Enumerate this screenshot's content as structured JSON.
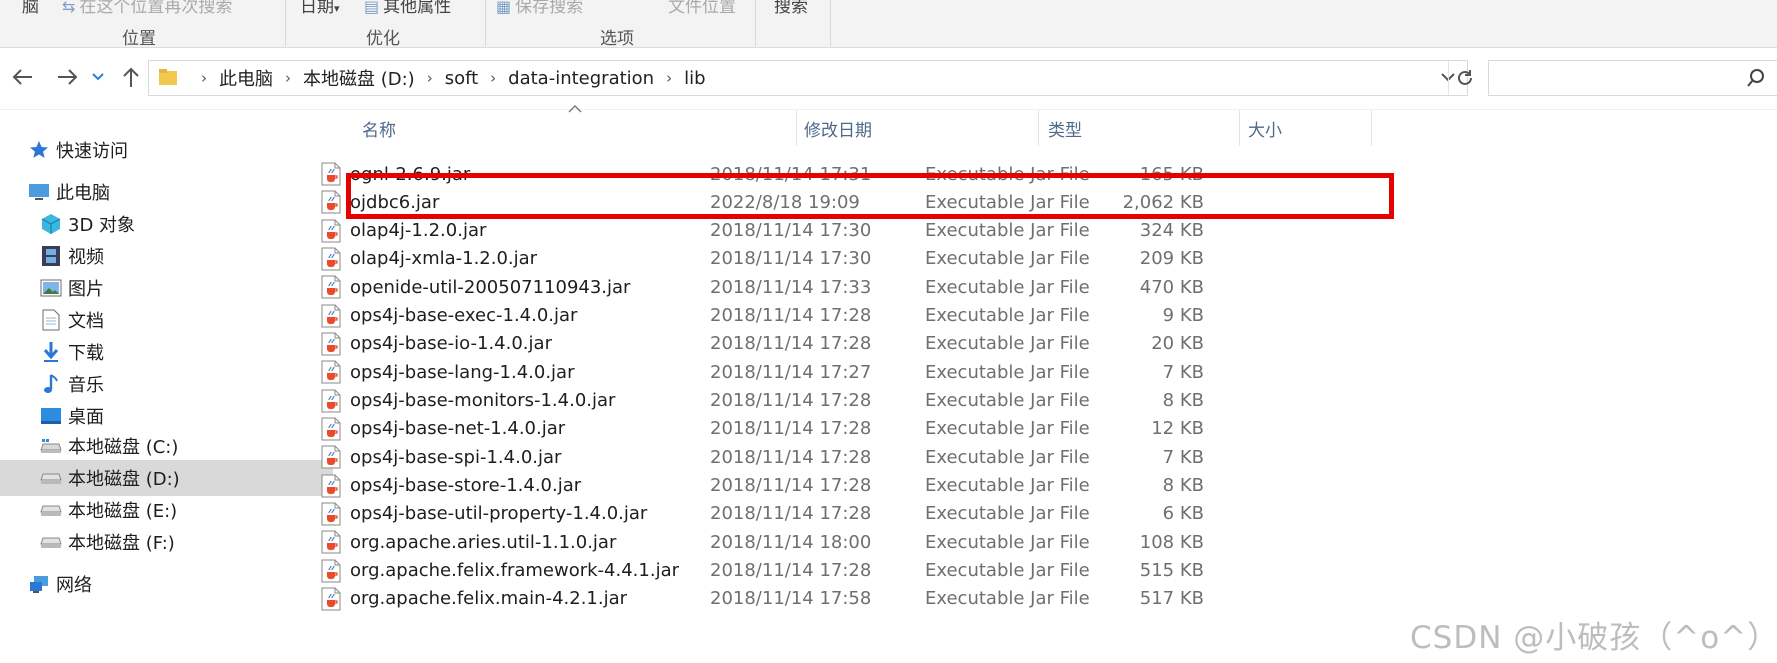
{
  "ribbon": {
    "buttons": [
      {
        "label": "脑",
        "icon": "",
        "dim": false
      },
      {
        "label": "在这个位置再次搜索",
        "icon": "search-again-icon",
        "dim": true
      },
      {
        "label": "日期",
        "icon": "",
        "dim": false
      },
      {
        "label": "其他属性",
        "icon": "properties-icon",
        "dim": false
      },
      {
        "label": "保存搜索",
        "icon": "save-search-icon",
        "dim": true
      },
      {
        "label": "文件位置",
        "icon": "",
        "dim": true
      },
      {
        "label": "搜索",
        "icon": "",
        "dim": false
      }
    ],
    "groups": [
      "位置",
      "优化",
      "选项"
    ]
  },
  "address": {
    "crumbs": [
      "此电脑",
      "本地磁盘 (D:)",
      "soft",
      "data-integration",
      "lib"
    ],
    "search_placeholder": ""
  },
  "nav": {
    "items": [
      {
        "label": "快速访问",
        "icon": "star-icon",
        "indent": 1,
        "selected": false
      },
      {
        "label": "此电脑",
        "icon": "computer-icon",
        "indent": 1,
        "selected": false
      },
      {
        "label": "3D 对象",
        "icon": "3d-objects-icon",
        "indent": 2,
        "selected": false
      },
      {
        "label": "视频",
        "icon": "video-icon",
        "indent": 2,
        "selected": false
      },
      {
        "label": "图片",
        "icon": "pictures-icon",
        "indent": 2,
        "selected": false
      },
      {
        "label": "文档",
        "icon": "documents-icon",
        "indent": 2,
        "selected": false
      },
      {
        "label": "下载",
        "icon": "download-icon",
        "indent": 2,
        "selected": false
      },
      {
        "label": "音乐",
        "icon": "music-icon",
        "indent": 2,
        "selected": false
      },
      {
        "label": "桌面",
        "icon": "desktop-icon",
        "indent": 2,
        "selected": false
      },
      {
        "label": "本地磁盘 (C:)",
        "icon": "drive-c-icon",
        "indent": 2,
        "selected": false
      },
      {
        "label": "本地磁盘 (D:)",
        "icon": "drive-icon",
        "indent": 2,
        "selected": true
      },
      {
        "label": "本地磁盘 (E:)",
        "icon": "drive-icon",
        "indent": 2,
        "selected": false
      },
      {
        "label": "本地磁盘 (F:)",
        "icon": "drive-icon",
        "indent": 2,
        "selected": false
      },
      {
        "label": "网络",
        "icon": "network-icon",
        "indent": 1,
        "selected": false
      }
    ]
  },
  "list": {
    "headers": {
      "name": "名称",
      "modified": "修改日期",
      "type": "类型",
      "size": "大小"
    },
    "rows": [
      {
        "name": "ognl-2.6.9.jar",
        "modified": "2018/11/14 17:31",
        "type": "Executable Jar File",
        "size": "165 KB"
      },
      {
        "name": "ojdbc6.jar",
        "modified": "2022/8/18 19:09",
        "type": "Executable Jar File",
        "size": "2,062 KB"
      },
      {
        "name": "olap4j-1.2.0.jar",
        "modified": "2018/11/14 17:30",
        "type": "Executable Jar File",
        "size": "324 KB"
      },
      {
        "name": "olap4j-xmla-1.2.0.jar",
        "modified": "2018/11/14 17:30",
        "type": "Executable Jar File",
        "size": "209 KB"
      },
      {
        "name": "openide-util-200507110943.jar",
        "modified": "2018/11/14 17:33",
        "type": "Executable Jar File",
        "size": "470 KB"
      },
      {
        "name": "ops4j-base-exec-1.4.0.jar",
        "modified": "2018/11/14 17:28",
        "type": "Executable Jar File",
        "size": "9 KB"
      },
      {
        "name": "ops4j-base-io-1.4.0.jar",
        "modified": "2018/11/14 17:28",
        "type": "Executable Jar File",
        "size": "20 KB"
      },
      {
        "name": "ops4j-base-lang-1.4.0.jar",
        "modified": "2018/11/14 17:27",
        "type": "Executable Jar File",
        "size": "7 KB"
      },
      {
        "name": "ops4j-base-monitors-1.4.0.jar",
        "modified": "2018/11/14 17:28",
        "type": "Executable Jar File",
        "size": "8 KB"
      },
      {
        "name": "ops4j-base-net-1.4.0.jar",
        "modified": "2018/11/14 17:28",
        "type": "Executable Jar File",
        "size": "12 KB"
      },
      {
        "name": "ops4j-base-spi-1.4.0.jar",
        "modified": "2018/11/14 17:28",
        "type": "Executable Jar File",
        "size": "7 KB"
      },
      {
        "name": "ops4j-base-store-1.4.0.jar",
        "modified": "2018/11/14 17:28",
        "type": "Executable Jar File",
        "size": "8 KB"
      },
      {
        "name": "ops4j-base-util-property-1.4.0.jar",
        "modified": "2018/11/14 17:28",
        "type": "Executable Jar File",
        "size": "6 KB"
      },
      {
        "name": "org.apache.aries.util-1.1.0.jar",
        "modified": "2018/11/14 18:00",
        "type": "Executable Jar File",
        "size": "108 KB"
      },
      {
        "name": "org.apache.felix.framework-4.4.1.jar",
        "modified": "2018/11/14 17:28",
        "type": "Executable Jar File",
        "size": "515 KB"
      },
      {
        "name": "org.apache.felix.main-4.2.1.jar",
        "modified": "2018/11/14 17:58",
        "type": "Executable Jar File",
        "size": "517 KB"
      }
    ]
  },
  "colors": {
    "highlight": "#e60000",
    "selected_nav": "#d9d9d9",
    "header_text": "#4d6a8a"
  },
  "watermark": "CSDN @小破孩（^o^）"
}
